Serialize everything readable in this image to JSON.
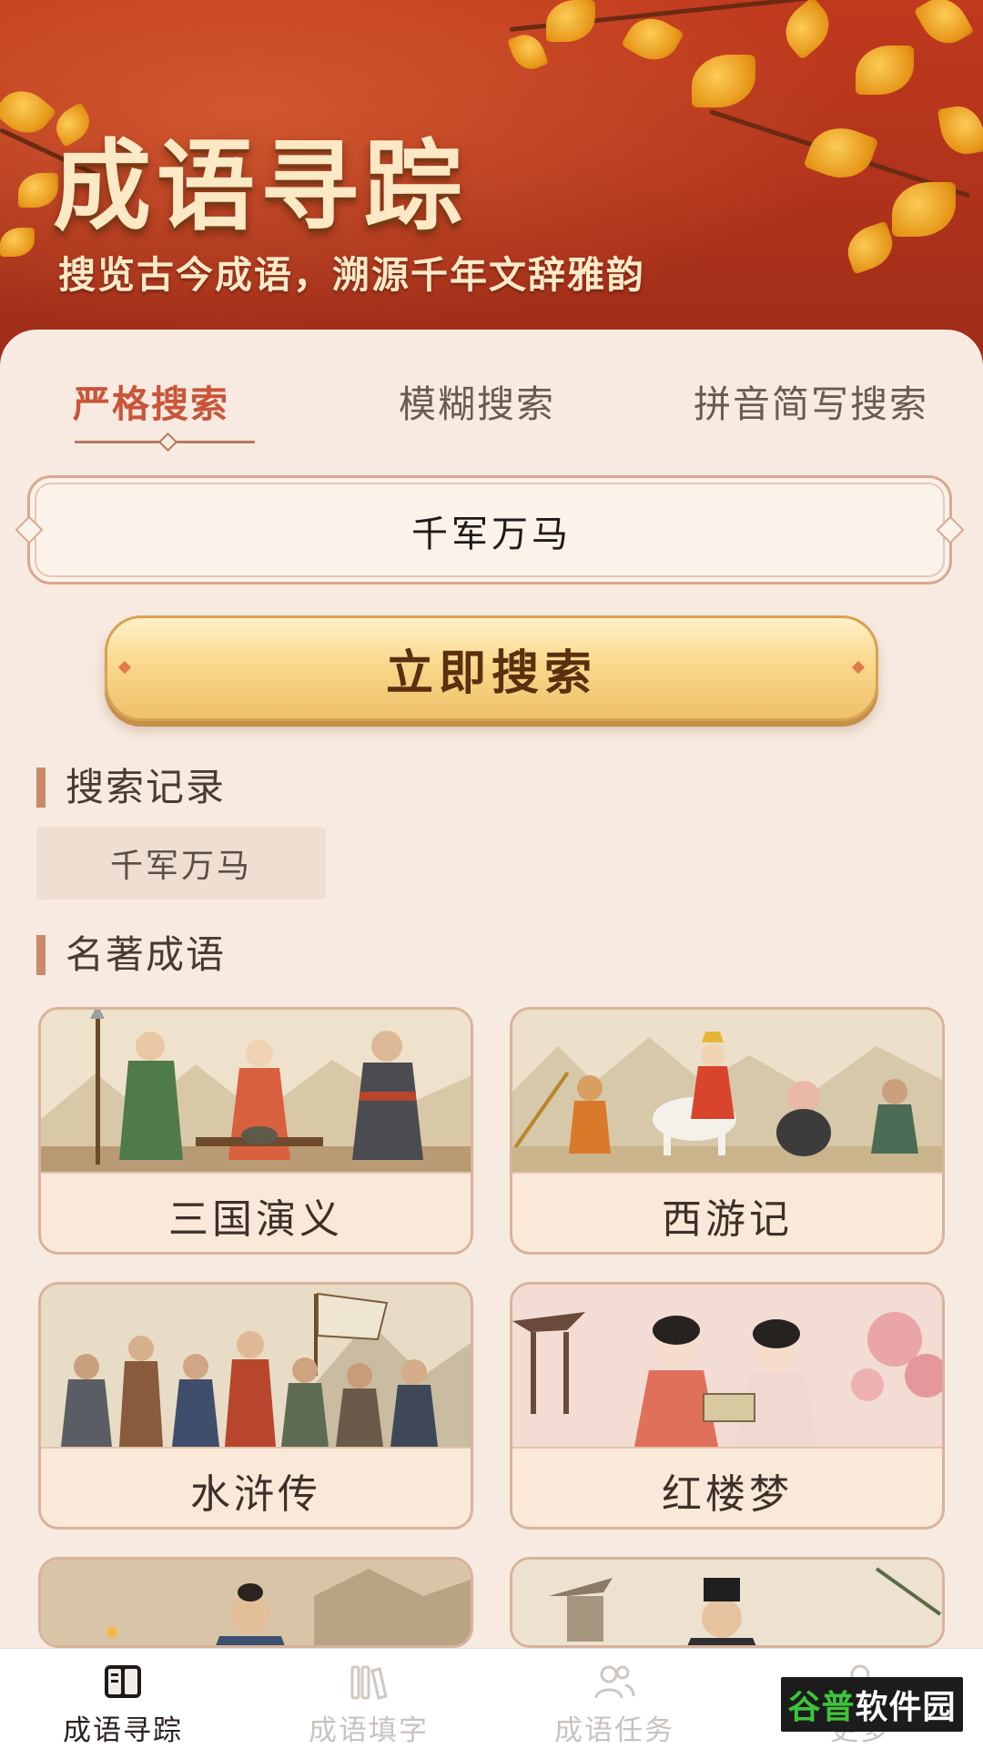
{
  "header": {
    "title": "成语寻踪",
    "subtitle": "搜览古今成语，溯源千年文辞雅韵"
  },
  "tabs": [
    {
      "label": "严格搜索",
      "active": true
    },
    {
      "label": "模糊搜索",
      "active": false
    },
    {
      "label": "拼音简写搜索",
      "active": false
    }
  ],
  "search": {
    "value": "千军万马",
    "button_label": "立即搜索"
  },
  "history": {
    "title": "搜索记录",
    "items": [
      "千军万马"
    ]
  },
  "books": {
    "title": "名著成语",
    "items": [
      "三国演义",
      "西游记",
      "水浒传",
      "红楼梦"
    ]
  },
  "bottom_nav": {
    "items": [
      {
        "label": "成语寻踪",
        "icon": "book-icon",
        "active": true
      },
      {
        "label": "成语填字",
        "icon": "books-shelf-icon",
        "active": false
      },
      {
        "label": "成语任务",
        "icon": "users-icon",
        "active": false
      },
      {
        "label": "更多",
        "icon": "user-icon",
        "active": false
      }
    ]
  },
  "watermark": {
    "text_green": "谷普",
    "text_white": "软件园"
  },
  "colors": {
    "header_red": "#b2341c",
    "accent": "#c9553a",
    "button_gold": "#f9d98c",
    "panel_bg": "#f7ebe1"
  }
}
